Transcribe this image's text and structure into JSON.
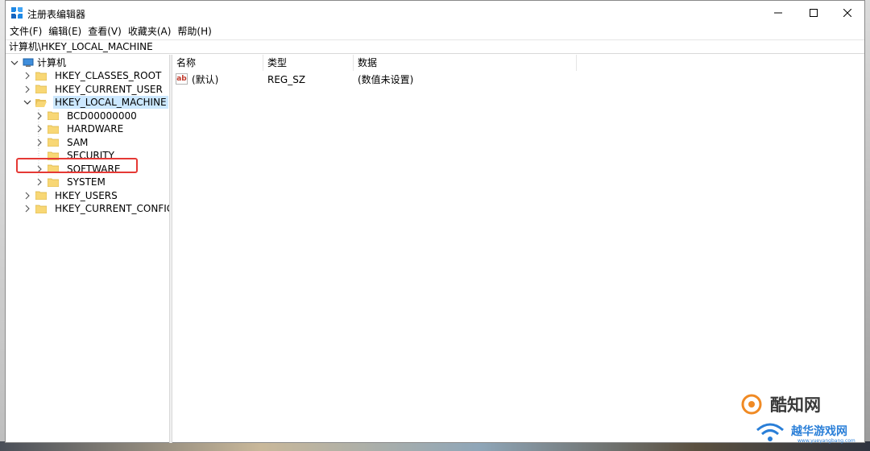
{
  "window": {
    "title": "注册表编辑器"
  },
  "menu": [
    {
      "label": "文件(F)"
    },
    {
      "label": "编辑(E)"
    },
    {
      "label": "查看(V)"
    },
    {
      "label": "收藏夹(A)"
    },
    {
      "label": "帮助(H)"
    }
  ],
  "address": {
    "path": "计算机\\HKEY_LOCAL_MACHINE"
  },
  "tree": {
    "root": "计算机",
    "nodes": [
      {
        "label": "HKEY_CLASSES_ROOT",
        "expanded": false
      },
      {
        "label": "HKEY_CURRENT_USER",
        "expanded": false
      },
      {
        "label": "HKEY_LOCAL_MACHINE",
        "expanded": true,
        "selected": true
      },
      {
        "label": "BCD00000000",
        "expanded": false
      },
      {
        "label": "HARDWARE",
        "expanded": false
      },
      {
        "label": "SAM",
        "expanded": false
      },
      {
        "label": "SECURITY",
        "expanded": false
      },
      {
        "label": "SOFTWARE",
        "expanded": false,
        "highlighted": true
      },
      {
        "label": "SYSTEM",
        "expanded": false
      },
      {
        "label": "HKEY_USERS",
        "expanded": false
      },
      {
        "label": "HKEY_CURRENT_CONFIG",
        "expanded": false
      }
    ]
  },
  "list": {
    "columns": [
      "名称",
      "类型",
      "数据"
    ],
    "rows": [
      {
        "name": "(默认)",
        "type": "REG_SZ",
        "data": "(数值未设置)"
      }
    ]
  },
  "watermarks": {
    "primary": "酷知网",
    "secondary": "越华游戏网",
    "secondary_url": "www.yueyangbang.com"
  },
  "colors": {
    "selection": "#cce8ff",
    "highlight_box": "#e53935",
    "folder": "#f8d775"
  }
}
